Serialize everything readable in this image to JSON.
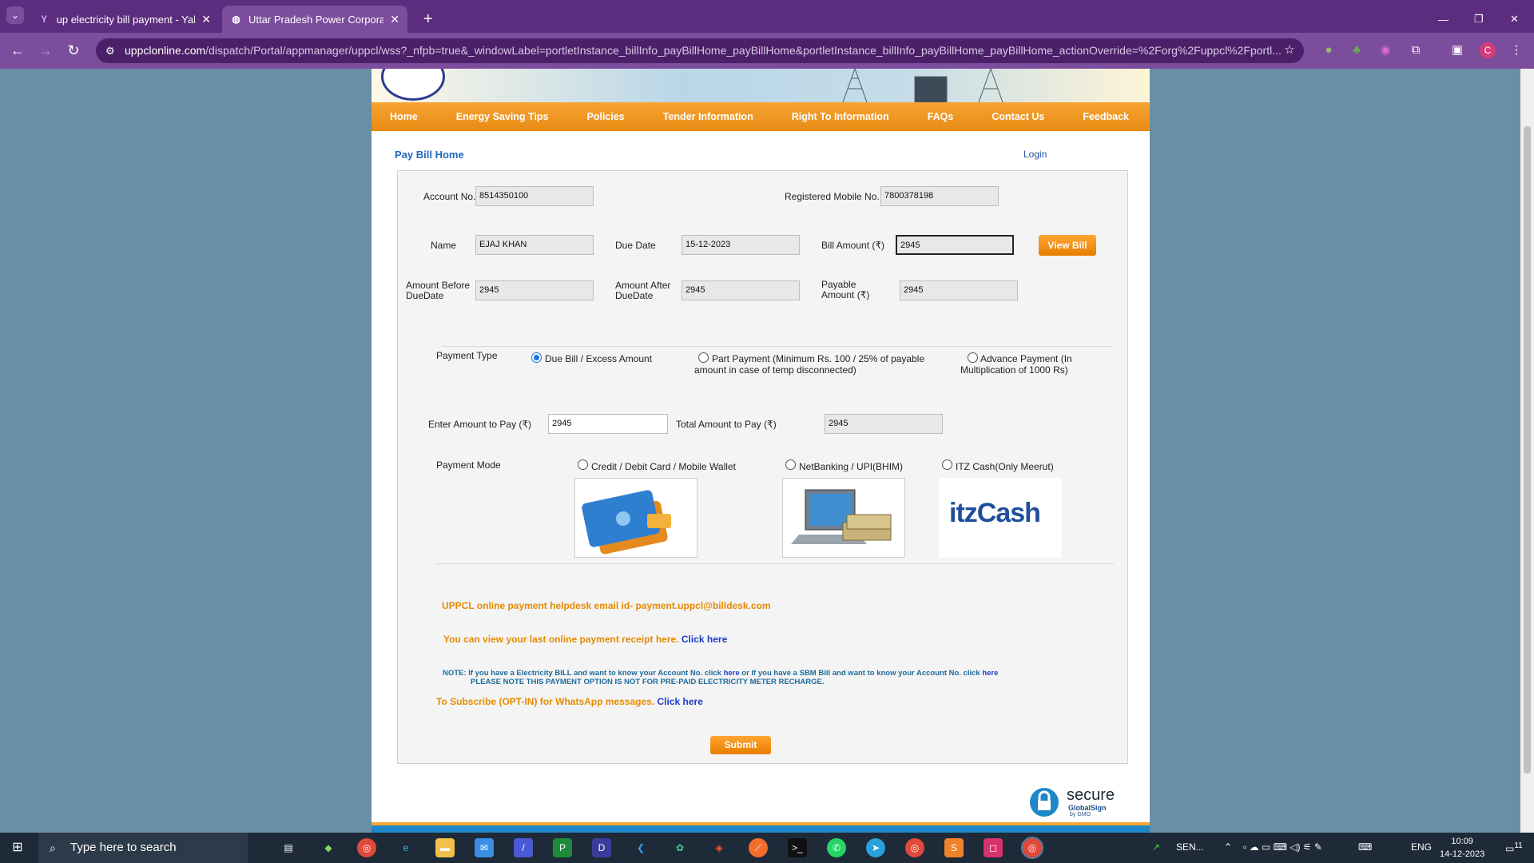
{
  "browser": {
    "tabs": [
      {
        "title": "up electricity bill payment - Yah",
        "icon": "yahoo-icon"
      },
      {
        "title": "Uttar Pradesh Power Corporatio",
        "icon": "globe-icon"
      }
    ],
    "url_host": "uppclonline.com",
    "url_path": "/dispatch/Portal/appmanager/uppcl/wss?_nfpb=true&_windowLabel=portletInstance_billInfo_payBillHome_payBillHome&portletInstance_billInfo_payBillHome_payBillHome_actionOverride=%2Forg%2Fuppcl%2Fportl...",
    "profile_initial": "C"
  },
  "nav": {
    "items": [
      "Home",
      "Energy Saving Tips",
      "Policies",
      "Tender Information",
      "Right To Information",
      "FAQs",
      "Contact Us",
      "Feedback"
    ]
  },
  "page": {
    "heading": "Pay Bill Home",
    "login": "Login"
  },
  "form": {
    "account_label": "Account No.",
    "account_value": "8514350100",
    "mobile_label": "Registered Mobile No.",
    "mobile_value": "7800378198",
    "name_label": "Name",
    "name_value": "EJAJ KHAN",
    "due_date_label": "Due Date",
    "due_date_value": "15-12-2023",
    "bill_amount_label": "Bill Amount (₹)",
    "bill_amount_value": "2945",
    "view_bill": "View Bill",
    "amt_before_label": "Amount Before DueDate",
    "amt_before_value": "2945",
    "amt_after_label": "Amount After DueDate",
    "amt_after_value": "2945",
    "payable_label": "Payable Amount (₹)",
    "payable_value": "2945",
    "payment_type_label": "Payment Type",
    "pt_due": "Due Bill / Excess Amount",
    "pt_part_1": "Part Payment  (Minimum Rs. 100 / 25% of payable",
    "pt_part_2": "amount in case of temp disconnected)",
    "pt_adv_1": "Advance Payment  (In",
    "pt_adv_2": "Multiplication of 1000 Rs)",
    "enter_amount_label": "Enter Amount to Pay (₹)",
    "enter_amount_value": "2945",
    "total_label": "Total Amount to Pay (₹)",
    "total_value": "2945",
    "payment_mode_label": "Payment Mode",
    "pm_card": "Credit / Debit Card / Mobile Wallet",
    "pm_net": "NetBanking / UPI(BHIM)",
    "pm_itz": "ITZ Cash(Only Meerut)",
    "itz_logo_text": "itzCash",
    "helpdesk": "UPPCL online payment helpdesk email id- payment.uppcl@billdesk.com",
    "receipt_text": "You can view your last online payment receipt here.",
    "receipt_link": "Click here",
    "note_1a": "NOTE: If you have a Electricity BILL and want to know your Account No. click",
    "note_1b": "here",
    "note_1c": "or If you have a SBM Bill and want to know your Account No. click",
    "note_1d": "here",
    "note_2": "PLEASE NOTE THIS PAYMENT OPTION IS NOT FOR PRE-PAID ELECTRICITY METER RECHARGE.",
    "whatsapp_text": "To Subscribe (OPT-IN) for WhatsApp messages.",
    "whatsapp_link": "Click here",
    "submit": "Submit",
    "ssl_secure": "secure",
    "ssl_brand": "GlobalSign",
    "ssl_by": "by GMO"
  },
  "taskbar": {
    "search_placeholder": "Type here to search",
    "weather": "SEN...",
    "lang": "ENG",
    "time": "10:09",
    "date": "14-12-2023",
    "notifications": "11"
  }
}
